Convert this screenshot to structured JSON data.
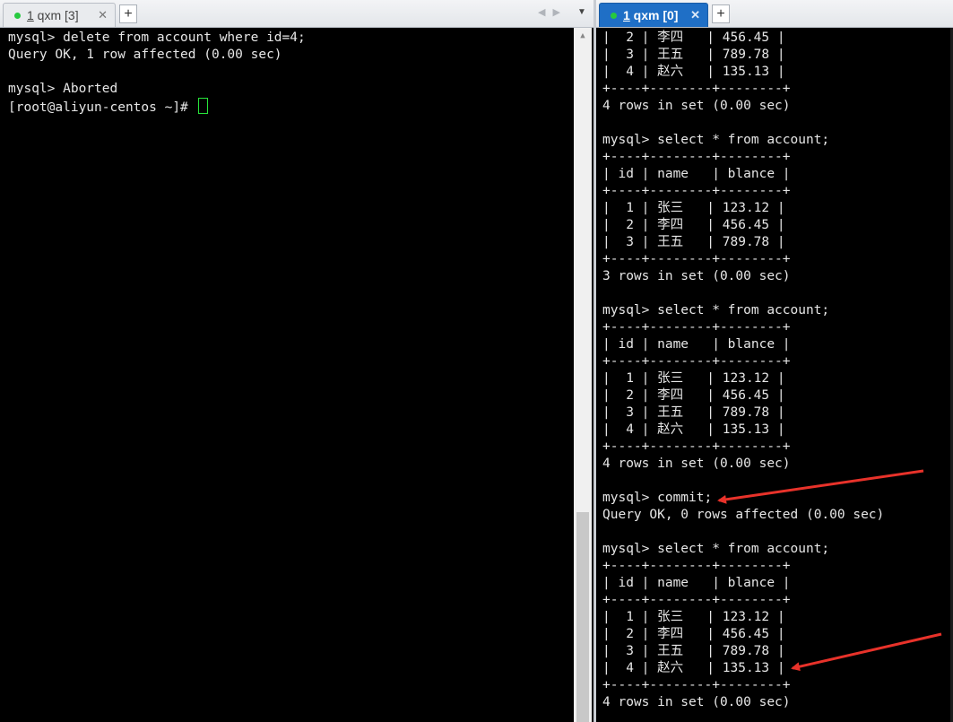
{
  "left_tab": {
    "dot_color": "#27c93f",
    "num": "1",
    "title": " qxm [3]",
    "close": "✕",
    "new": "+"
  },
  "right_tab": {
    "dot_color": "#27c93f",
    "num": "1",
    "title": " qxm [0]",
    "close": "✕",
    "new": "+"
  },
  "tab_nav": {
    "prev": "◀",
    "next": "▶",
    "menu": "▼"
  },
  "left_terminal": {
    "lines": [
      "mysql> delete from account where id=4;",
      "Query OK, 1 row affected (0.00 sec)",
      "",
      "mysql> Aborted",
      "[root@aliyun-centos ~]# "
    ]
  },
  "right_terminal": {
    "lines": [
      "|  2 | 李四   | 456.45 |",
      "|  3 | 王五   | 789.78 |",
      "|  4 | 赵六   | 135.13 |",
      "+----+--------+--------+",
      "4 rows in set (0.00 sec)",
      "",
      "mysql> select * from account;",
      "+----+--------+--------+",
      "| id | name   | blance |",
      "+----+--------+--------+",
      "|  1 | 张三   | 123.12 |",
      "|  2 | 李四   | 456.45 |",
      "|  3 | 王五   | 789.78 |",
      "+----+--------+--------+",
      "3 rows in set (0.00 sec)",
      "",
      "mysql> select * from account;",
      "+----+--------+--------+",
      "| id | name   | blance |",
      "+----+--------+--------+",
      "|  1 | 张三   | 123.12 |",
      "|  2 | 李四   | 456.45 |",
      "|  3 | 王五   | 789.78 |",
      "|  4 | 赵六   | 135.13 |",
      "+----+--------+--------+",
      "4 rows in set (0.00 sec)",
      "",
      "mysql> commit;",
      "Query OK, 0 rows affected (0.00 sec)",
      "",
      "mysql> select * from account;",
      "+----+--------+--------+",
      "| id | name   | blance |",
      "+----+--------+--------+",
      "|  1 | 张三   | 123.12 |",
      "|  2 | 李四   | 456.45 |",
      "|  3 | 王五   | 789.78 |",
      "|  4 | 赵六   | 135.13 |",
      "+----+--------+--------+",
      "4 rows in set (0.00 sec)"
    ]
  },
  "annotation_color": "#e8322a"
}
